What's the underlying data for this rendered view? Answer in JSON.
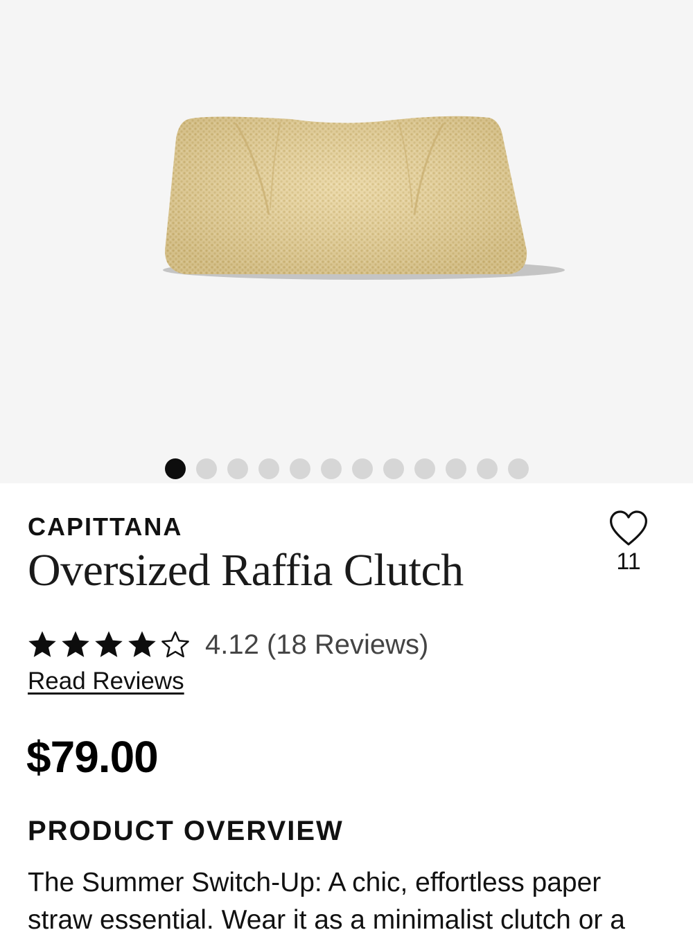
{
  "gallery": {
    "image_label": "oversized raffia clutch product photo",
    "dot_count": 12,
    "active_index": 0
  },
  "product": {
    "brand": "CAPITTANA",
    "title": "Oversized Raffia Clutch",
    "favorite_count": "11",
    "rating": 4.12,
    "rating_max": 5,
    "rating_text": "4.12 (18 Reviews)",
    "read_reviews_label": "Read Reviews",
    "price": "$79.00"
  },
  "overview": {
    "heading": "PRODUCT OVERVIEW",
    "text": "The Summer Switch-Up: A chic, effortless paper straw essential. Wear it as a minimalist clutch or a"
  },
  "icons": {
    "favorite": "heart-outline-icon",
    "star_filled": "star-filled-icon",
    "star_empty": "star-outline-icon"
  },
  "colors": {
    "gallery_bg": "#f5f5f5",
    "dot_active": "#0d0d0d",
    "dot_inactive": "#d6d6d6",
    "clutch": "#e9d49b"
  }
}
